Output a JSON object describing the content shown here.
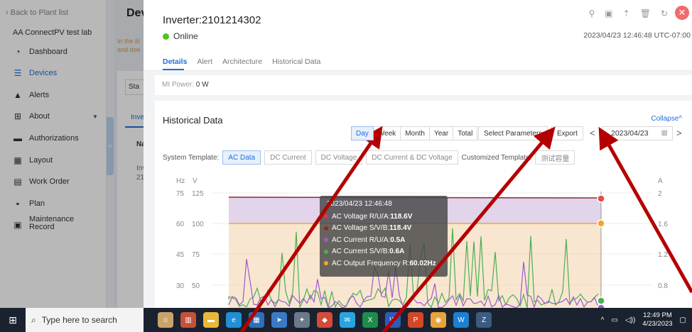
{
  "sidebar": {
    "back_label": "Back to Plant list",
    "lab_name": "AA ConnectPV test lab",
    "items": [
      {
        "label": "Dashboard",
        "icon": "dashboard-icon"
      },
      {
        "label": "Devices",
        "icon": "devices-icon",
        "active": true
      },
      {
        "label": "Alerts",
        "icon": "alert-icon"
      },
      {
        "label": "About",
        "icon": "about-icon",
        "caret": true
      },
      {
        "label": "Authorizations",
        "icon": "authorizations-icon"
      },
      {
        "label": "Layout",
        "icon": "layout-icon"
      },
      {
        "label": "Work Order",
        "icon": "work-order-icon"
      },
      {
        "label": "Plan",
        "icon": "plan-icon"
      },
      {
        "label": "Maintenance Record",
        "icon": "maintenance-icon"
      }
    ]
  },
  "background": {
    "title": "Devic",
    "hint": "In the lit and doe",
    "status_select": "Sta",
    "tab_inverter": "Inve",
    "col_name": "Na",
    "row_1": "Inv",
    "row_2": "21"
  },
  "drawer": {
    "title": "Inverter:2101214302",
    "status": "Online",
    "timestamp": "2023/04/23 12:46:48 UTC-07:00",
    "tabs": [
      "Details",
      "Alert",
      "Architecture",
      "Historical Data"
    ],
    "active_tab": "Details",
    "mi_power_label": "MI Power:",
    "mi_power_value": "0 W"
  },
  "historical": {
    "title": "Historical Data",
    "collapse": "Collapse",
    "periods": [
      "Day",
      "Week",
      "Month",
      "Year",
      "Total"
    ],
    "selected_period": "Day",
    "select_parameters": "Select Parameters",
    "export": "Export",
    "date": "2023/04/23",
    "system_template_label": "System Template:",
    "templates": [
      "AC Data",
      "DC Current",
      "DC Voltage",
      "DC Current & DC Voltage"
    ],
    "selected_template": "AC Data",
    "customized_template_label": "Customized Template:",
    "customized_template_chip": "测试容量"
  },
  "chart_data": {
    "type": "line",
    "left_axis_units": [
      "Hz",
      "V"
    ],
    "right_axis_unit": "A",
    "left_ticks_hz": [
      75,
      60,
      45,
      30
    ],
    "left_ticks_v": [
      125,
      100,
      75,
      50
    ],
    "right_ticks_a": [
      2,
      1.6,
      1.2,
      0.8
    ],
    "series": [
      {
        "name": "AC Voltage R/U/A",
        "color": "#d9363e"
      },
      {
        "name": "AC Voltage S/V/B",
        "color": "#8b2a2a"
      },
      {
        "name": "AC Current R/U/A",
        "color": "#9b59d0"
      },
      {
        "name": "AC Current S/V/B",
        "color": "#4caf50"
      },
      {
        "name": "AC Output Frequency R",
        "color": "#f5a623"
      }
    ],
    "tooltip": {
      "time": "2023/04/23 12:46:48",
      "rows": [
        {
          "label": "AC Voltage R/U/A:",
          "value": "118.6V",
          "color": "#d9363e"
        },
        {
          "label": "AC Voltage S/V/B:",
          "value": "118.4V",
          "color": "#8b2a2a"
        },
        {
          "label": "AC Current R/U/A:",
          "value": "0.5A",
          "color": "#9b59d0"
        },
        {
          "label": "AC Current S/V/B:",
          "value": "0.6A",
          "color": "#4caf50"
        },
        {
          "label": "AC Output Frequency R:",
          "value": "60.02Hz",
          "color": "#f5a623"
        }
      ]
    }
  },
  "taskbar": {
    "search_placeholder": "Type here to search",
    "time": "12:49 PM",
    "date": "4/23/2023"
  }
}
